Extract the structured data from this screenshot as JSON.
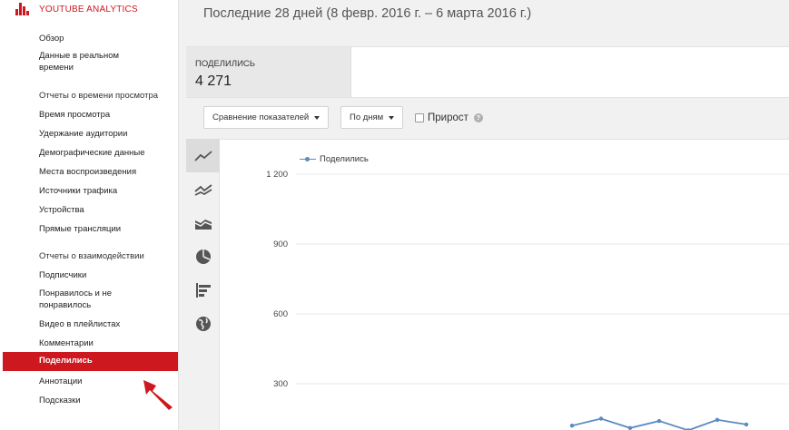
{
  "brand": {
    "title": "YOUTUBE ANALYTICS"
  },
  "nav": {
    "items": [
      {
        "label": "Обзор",
        "top": 36
      },
      {
        "label": "Данные в реальном\nвремени",
        "top": 55
      },
      {
        "label": "Отчеты о времени просмотра",
        "top": 99,
        "section": true
      },
      {
        "label": "Время просмотра",
        "top": 120
      },
      {
        "label": "Удержание аудитории",
        "top": 141
      },
      {
        "label": "Демографические данные",
        "top": 162
      },
      {
        "label": "Места воспроизведения",
        "top": 183
      },
      {
        "label": "Источники трафика",
        "top": 204
      },
      {
        "label": "Устройства",
        "top": 225
      },
      {
        "label": "Прямые трансляции",
        "top": 246
      },
      {
        "label": "Отчеты о взаимодействии",
        "top": 276,
        "section": true
      },
      {
        "label": "Подписчики",
        "top": 297
      },
      {
        "label": "Понравилось и не\nпонравилось",
        "top": 317
      },
      {
        "label": "Видео в плейлистах",
        "top": 351
      },
      {
        "label": "Комментарии",
        "top": 372
      },
      {
        "label": "Аннотации",
        "top": 414
      },
      {
        "label": "Подсказки",
        "top": 435
      }
    ],
    "active": "Поделились"
  },
  "header": {
    "date_range": "Последние 28 дней (8 февр. 2016 г. – 6 марта 2016 г.)"
  },
  "metric": {
    "label": "ПОДЕЛИЛИСЬ",
    "value": "4 271"
  },
  "controls": {
    "compare_label": "Сравнение показателей",
    "granularity_label": "По дням",
    "growth_label": "Прирост",
    "growth_checked": false
  },
  "chart_types": [
    "line-chart-icon",
    "multi-line-chart-icon",
    "area-chart-icon",
    "pie-chart-icon",
    "bar-chart-icon",
    "globe-map-icon"
  ],
  "chart_data": {
    "type": "line",
    "series": [
      {
        "name": "Поделились",
        "values": [
          120,
          150,
          110,
          140,
          100,
          145,
          125
        ]
      }
    ],
    "y_ticks": [
      "1 200",
      "900",
      "600",
      "300"
    ],
    "ylim": [
      0,
      1200
    ],
    "grid": true,
    "legend": "top-left",
    "color": "#5b8ac2"
  }
}
